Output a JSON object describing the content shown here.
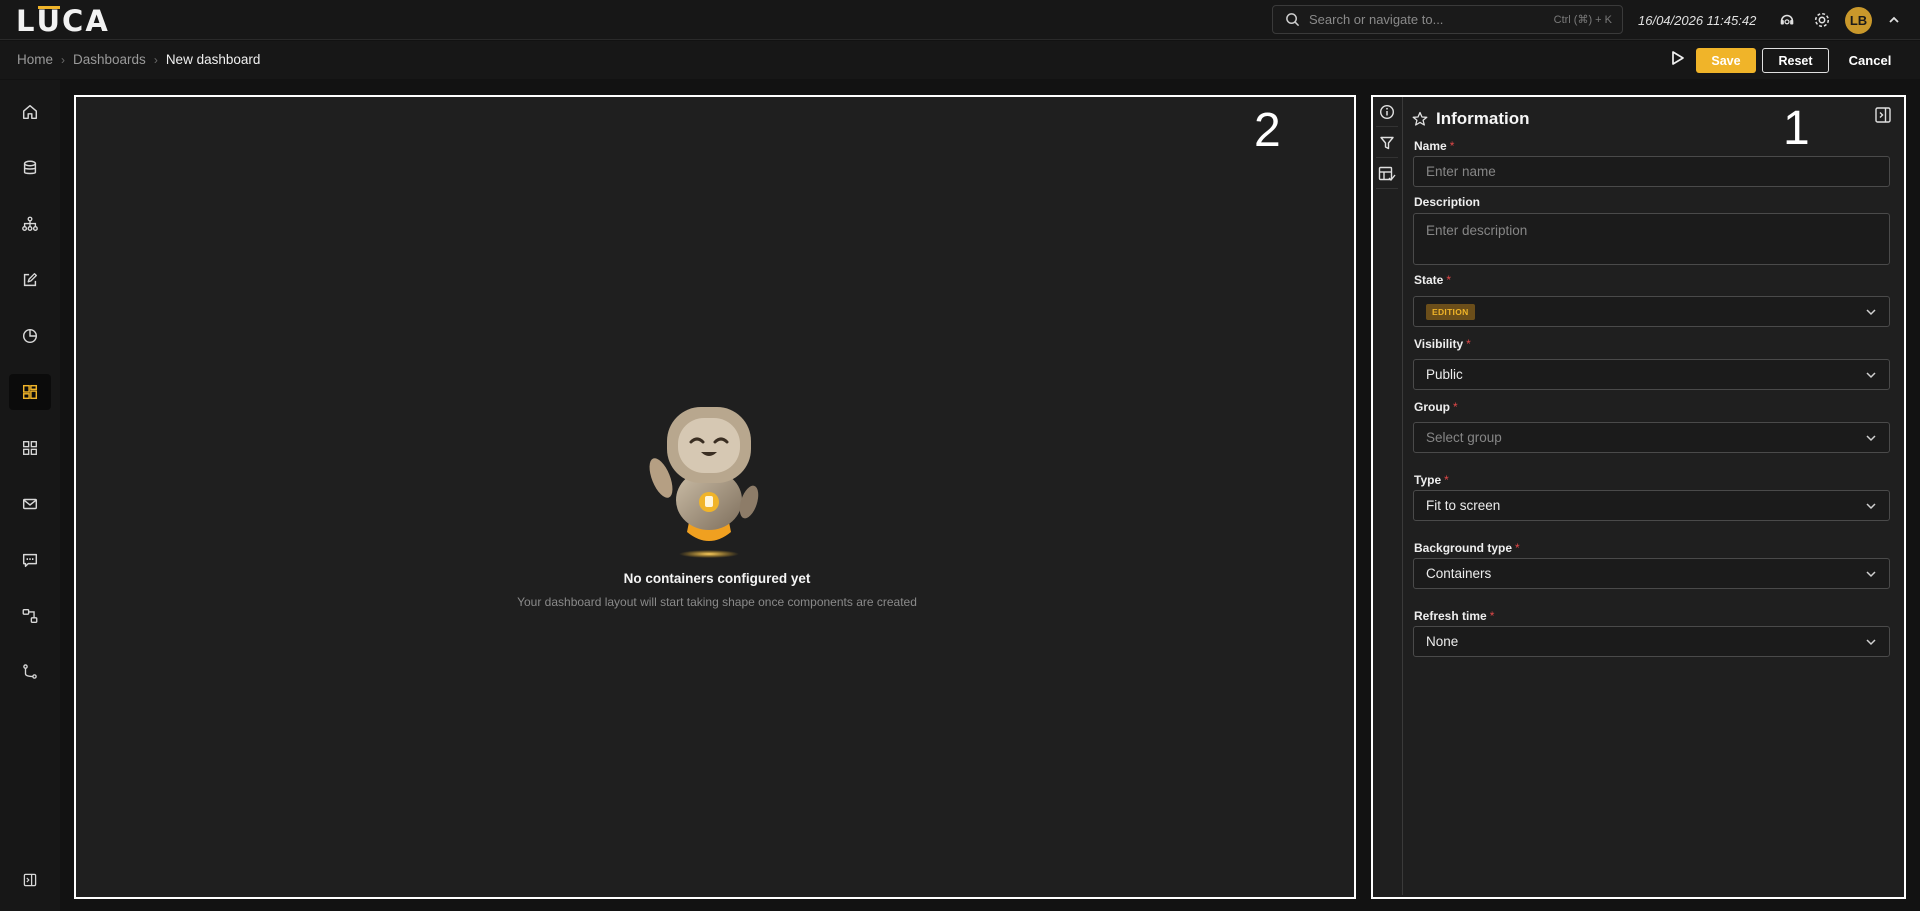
{
  "app": {
    "logo_text": "LUCA"
  },
  "search": {
    "placeholder": "Search or navigate to...",
    "shortcut": "Ctrl (⌘) + K"
  },
  "header": {
    "datetime": "16/04/2026 11:45:42",
    "avatar_initials": "LB"
  },
  "breadcrumb": {
    "items": [
      "Home",
      "Dashboards"
    ],
    "current": "New dashboard"
  },
  "actions": {
    "save_label": "Save",
    "reset_label": "Reset",
    "cancel_label": "Cancel"
  },
  "colors": {
    "accent": "#f0b429",
    "background": "#121212",
    "surface": "#1f1f1f",
    "required": "#e04848"
  },
  "sidebar": {
    "items": [
      {
        "icon": "home-icon"
      },
      {
        "icon": "database-icon"
      },
      {
        "icon": "hierarchy-icon"
      },
      {
        "icon": "edit-icon"
      },
      {
        "icon": "pie-chart-icon"
      },
      {
        "icon": "dashboard-icon",
        "active": true
      },
      {
        "icon": "grid-icon"
      },
      {
        "icon": "mail-icon"
      },
      {
        "icon": "message-icon"
      },
      {
        "icon": "workflow-icon"
      },
      {
        "icon": "git-branch-icon"
      }
    ],
    "bottom_icon": "sidebar-toggle-icon"
  },
  "canvas": {
    "marker": "2",
    "empty_title": "No containers configured yet",
    "empty_subtitle": "Your dashboard layout will start taking shape once components are created"
  },
  "panel": {
    "marker": "1",
    "title": "Information",
    "tabs": [
      "info-icon",
      "filter-icon",
      "layout-check-icon"
    ],
    "fields": {
      "name": {
        "label": "Name",
        "placeholder": "Enter name",
        "required": true
      },
      "description": {
        "label": "Description",
        "placeholder": "Enter description",
        "required": false
      },
      "state": {
        "label": "State",
        "value": "EDITION",
        "required": true
      },
      "visibility": {
        "label": "Visibility",
        "value": "Public",
        "required": true
      },
      "group": {
        "label": "Group",
        "placeholder": "Select group",
        "required": true
      },
      "type": {
        "label": "Type",
        "value": "Fit to screen",
        "required": true
      },
      "background_type": {
        "label": "Background type",
        "value": "Containers",
        "required": true
      },
      "refresh_time": {
        "label": "Refresh time",
        "value": "None",
        "required": true
      }
    },
    "required_mark": "*"
  }
}
